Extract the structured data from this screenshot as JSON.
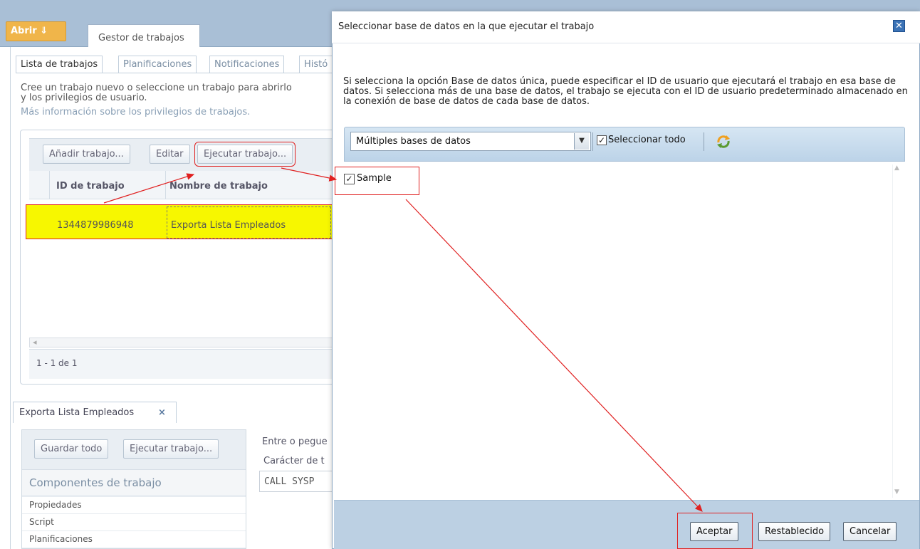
{
  "app": {
    "open_button": "Abrir ⇓",
    "main_tab": "Gestor de trabajos"
  },
  "background": {
    "tabs": [
      "Lista de trabajos",
      "Planificaciones",
      "Notificaciones",
      "Histó"
    ],
    "intro_lines": [
      "Cree un trabajo nuevo o seleccione un trabajo para abrirlo",
      "y los privilegios de usuario."
    ],
    "intro_link": "Más información sobre los privilegios de trabajos.",
    "toolbar": {
      "add": "Añadir trabajo...",
      "edit": "Editar",
      "run": "Ejecutar trabajo..."
    },
    "grid": {
      "headers": [
        "ID de trabajo",
        "Nombre de trabajo"
      ],
      "rows": [
        {
          "id": "1344879986948",
          "name": "Exporta Lista Empleados"
        }
      ],
      "pager": "1 - 1 de 1"
    },
    "editor": {
      "tab": "Exporta Lista Empleados",
      "tab_close": "×",
      "save_all": "Guardar todo",
      "run": "Ejecutar trabajo...",
      "components_title": "Componentes de trabajo",
      "components": [
        "Propiedades",
        "Script",
        "Planificaciones"
      ],
      "right_text1": "Entre o pegue",
      "right_text2": "Carácter de t",
      "code": "CALL SYSP"
    }
  },
  "dialog": {
    "title": "Seleccionar base de datos en la que ejecutar el trabajo",
    "close": "✕",
    "description": "Si selecciona la opción Base de datos única, puede especificar el ID de usuario que ejecutará el trabajo en esa base de datos. Si selecciona más de una base de datos, el trabajo se ejecuta con el ID de usuario predeterminado almacenado en la conexión de base de datos de cada base de datos.",
    "dropdown_value": "Múltiples bases de datos",
    "select_all": "Seleccionar todo",
    "select_all_checked": true,
    "databases": [
      {
        "name": "Sample",
        "checked": true
      }
    ],
    "buttons": {
      "ok": "Aceptar",
      "reset": "Restablecido",
      "cancel": "Cancelar"
    }
  },
  "colors": {
    "highlight_row": "#f7f700",
    "annotation_red": "#e02020",
    "dialog_footer": "#bcd0e3"
  },
  "icons": {
    "dropdown": "chevron-down-icon",
    "refresh": "refresh-icon",
    "close": "close-icon"
  }
}
